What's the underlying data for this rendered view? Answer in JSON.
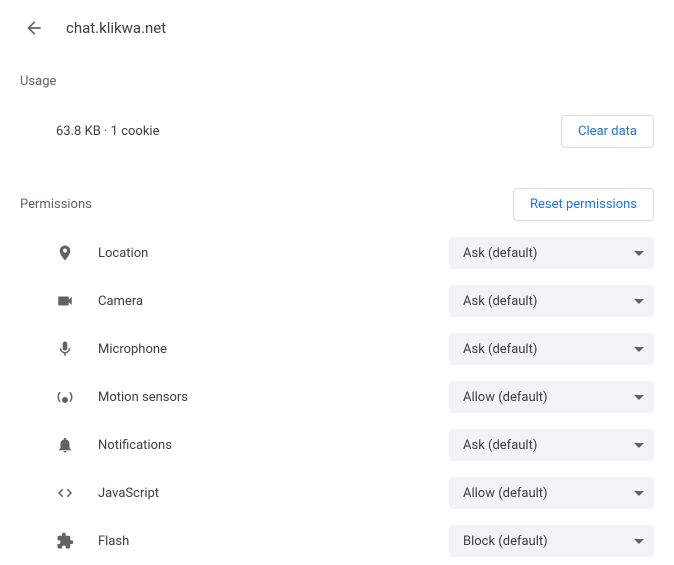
{
  "header": {
    "site": "chat.klikwa.net"
  },
  "usage": {
    "section_label": "Usage",
    "summary": "63.8 KB · 1 cookie",
    "clear_button": "Clear data"
  },
  "permissions": {
    "section_label": "Permissions",
    "reset_button": "Reset permissions",
    "items": [
      {
        "icon": "location-icon",
        "label": "Location",
        "value": "Ask (default)"
      },
      {
        "icon": "camera-icon",
        "label": "Camera",
        "value": "Ask (default)"
      },
      {
        "icon": "microphone-icon",
        "label": "Microphone",
        "value": "Ask (default)"
      },
      {
        "icon": "motion-sensors-icon",
        "label": "Motion sensors",
        "value": "Allow (default)"
      },
      {
        "icon": "notifications-icon",
        "label": "Notifications",
        "value": "Ask (default)"
      },
      {
        "icon": "javascript-icon",
        "label": "JavaScript",
        "value": "Allow (default)"
      },
      {
        "icon": "flash-icon",
        "label": "Flash",
        "value": "Block (default)"
      }
    ]
  }
}
